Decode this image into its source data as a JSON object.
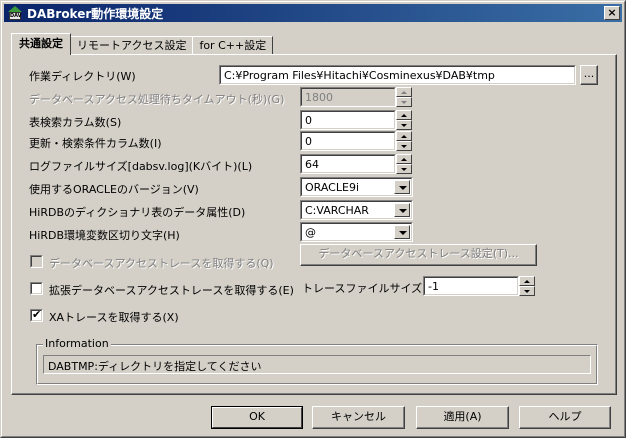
{
  "window": {
    "title": "DABroker動作環境設定",
    "close_label": "×",
    "icon_text": "DAV"
  },
  "tabs": [
    {
      "label": "共通設定",
      "active": true
    },
    {
      "label": "リモートアクセス設定",
      "active": false
    },
    {
      "label": "for C++設定",
      "active": false
    }
  ],
  "fields": {
    "work_dir_label": "作業ディレクトリ(W)",
    "work_dir_value": "C:¥Program Files¥Hitachi¥Cosminexus¥DAB¥tmp",
    "browse_label": "...",
    "db_timeout_label": "データベースアクセス処理待ちタイムアウト(秒)(G)",
    "db_timeout_value": "1800",
    "table_search_cols_label": "表検索カラム数(S)",
    "table_search_cols_value": "0",
    "update_search_cols_label": "更新・検索条件カラム数(I)",
    "update_search_cols_value": "0",
    "log_size_label": "ログファイルサイズ[dabsv.log](Kバイト)(L)",
    "log_size_value": "64",
    "oracle_version_label": "使用するORACLEのバージョン(V)",
    "oracle_version_value": "ORACLE9i",
    "hirdb_dict_label": "HiRDBのディクショナリ表のデータ属性(D)",
    "hirdb_dict_value": "C:VARCHAR",
    "hirdb_env_sep_label": "HiRDB環境変数区切り文字(H)",
    "hirdb_env_sep_value": "@"
  },
  "trace": {
    "db_trace_label": "データベースアクセストレースを取得する(Q)",
    "db_trace_settings_label": "データベースアクセストレース設定(T)...",
    "ext_trace_label": "拡張データベースアクセストレースを取得する(E)",
    "trace_file_size_label": "トレースファイルサイズ(F)",
    "trace_file_size_value": "-1",
    "xa_trace_label": "XAトレースを取得する(X)",
    "xa_trace_checked": true,
    "check_mark": "✔"
  },
  "information": {
    "legend": "Information",
    "message": "DABTMP:ディレクトリを指定してください"
  },
  "buttons": {
    "ok": "OK",
    "cancel": "キャンセル",
    "apply": "適用(A)",
    "help": "ヘルプ"
  }
}
